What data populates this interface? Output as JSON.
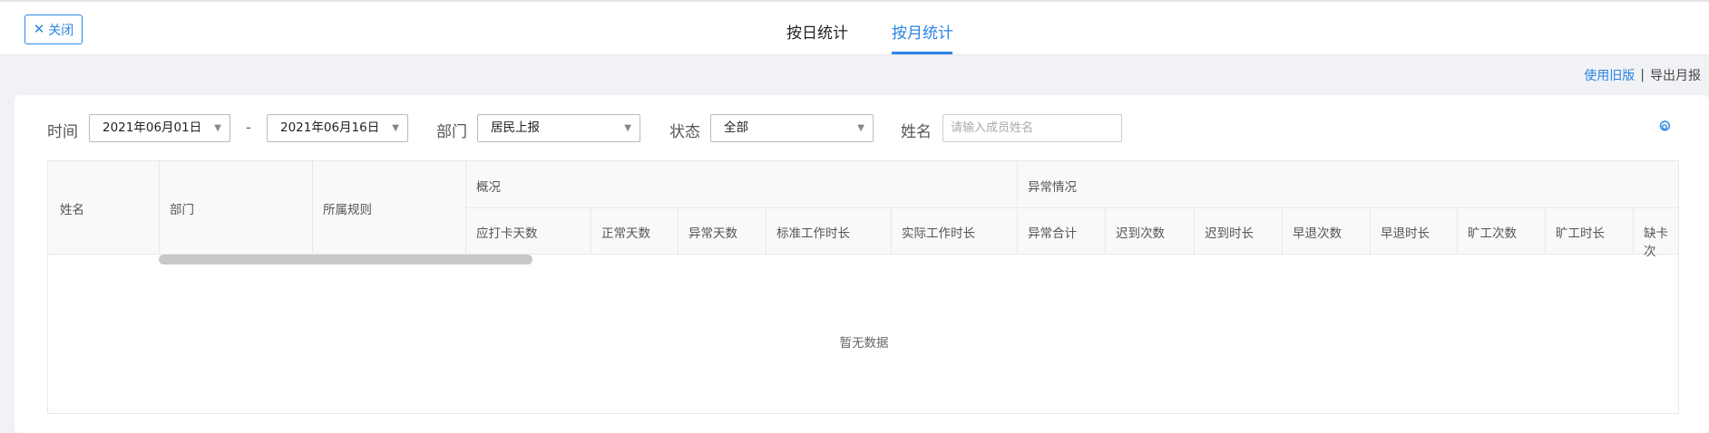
{
  "header": {
    "close_label": "关闭",
    "tabs": [
      {
        "label": "按日统计",
        "active": false
      },
      {
        "label": "按月统计",
        "active": true
      }
    ],
    "accent_color": "#2b85e4"
  },
  "links": {
    "use_old_version": "使用旧版",
    "separator": "|",
    "export_monthly": "导出月报"
  },
  "filters": {
    "time_label": "时间",
    "start_date": "2021年06月01日",
    "date_separator": "-",
    "end_date": "2021年06月16日",
    "dept_label": "部门",
    "dept_value": "居民上报",
    "status_label": "状态",
    "status_value": "全部",
    "name_label": "姓名",
    "name_placeholder": "请输入成员姓名"
  },
  "table": {
    "fixed_headers": [
      "姓名",
      "部门",
      "所属规则"
    ],
    "group_overview": "概况",
    "overview_columns": [
      "应打卡天数",
      "正常天数",
      "异常天数",
      "标准工作时长",
      "实际工作时长"
    ],
    "group_abnormal": "异常情况",
    "abnormal_columns": [
      "异常合计",
      "迟到次数",
      "迟到时长",
      "早退次数",
      "早退时长",
      "旷工次数",
      "旷工时长",
      "缺卡次"
    ],
    "empty_text": "暂无数据"
  },
  "icons": {
    "close": "close-icon",
    "caret": "caret-down-icon",
    "settings": "gear-icon"
  }
}
